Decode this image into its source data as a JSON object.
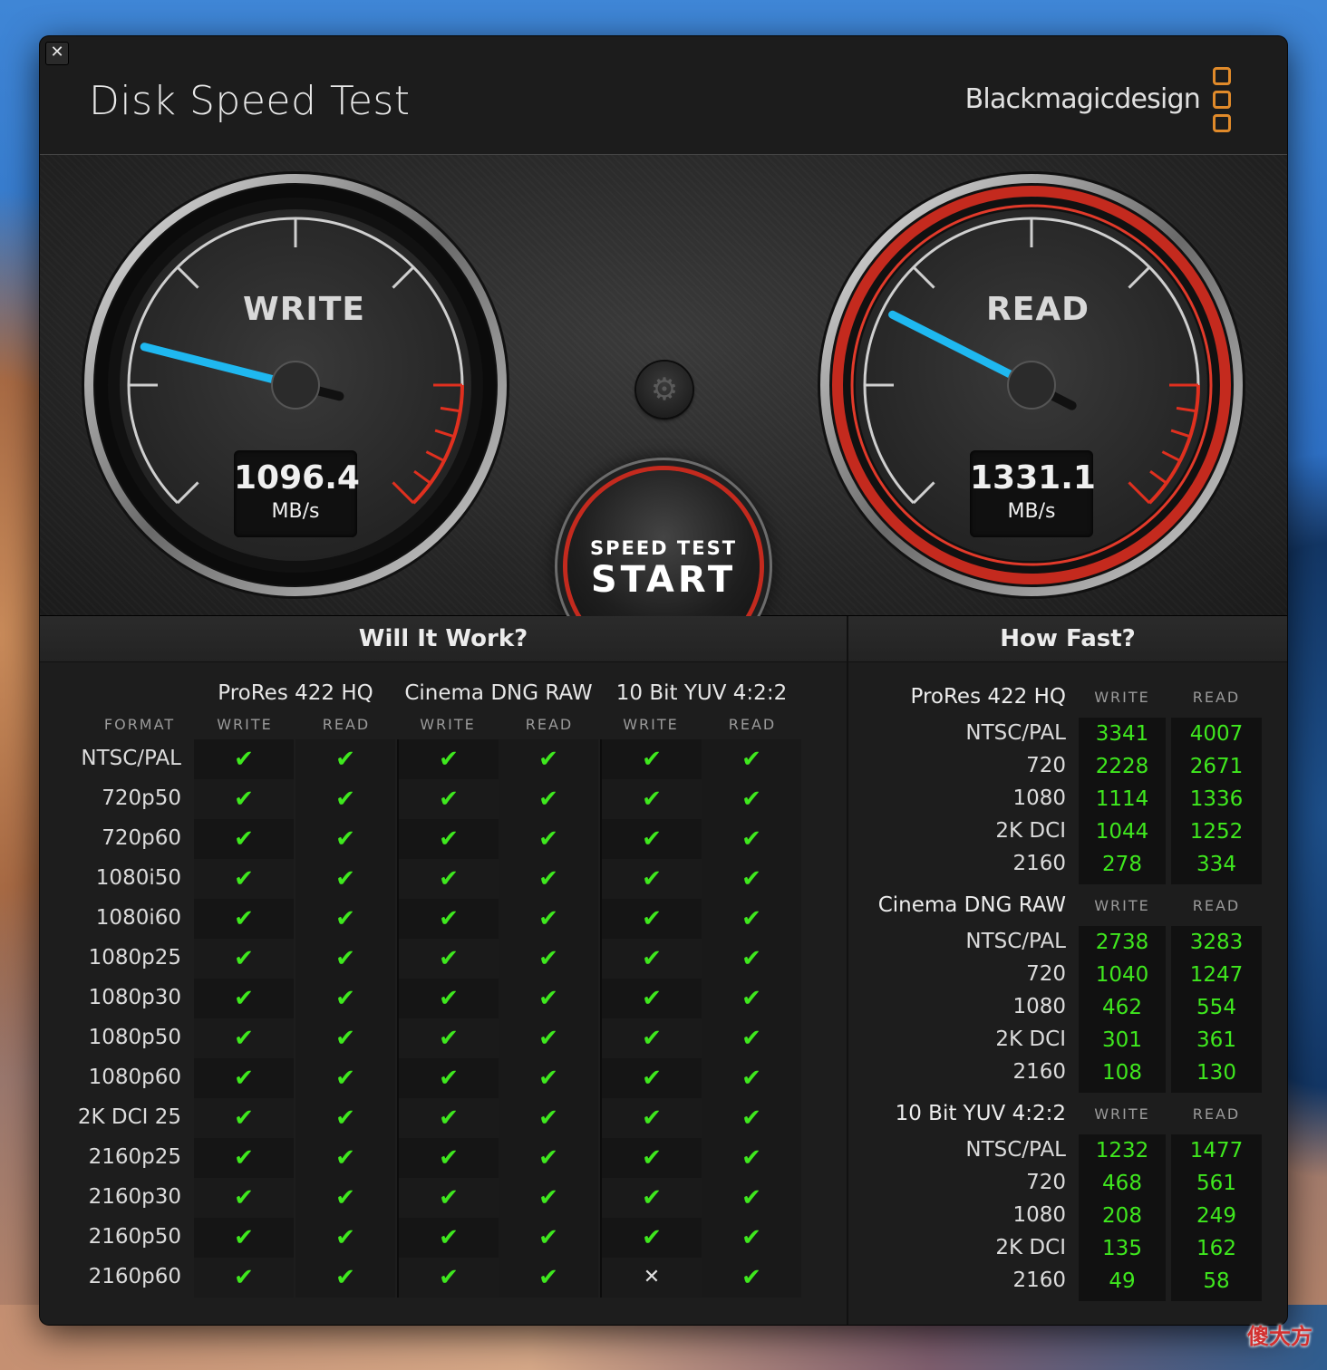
{
  "window": {
    "close": "✕",
    "title": "Disk Speed Test",
    "brand": "Blackmagicdesign"
  },
  "gauges": {
    "write": {
      "label": "WRITE",
      "value": "1096.4",
      "unit": "MB/s"
    },
    "read": {
      "label": "READ",
      "value": "1331.1",
      "unit": "MB/s"
    }
  },
  "start_button": {
    "line1": "SPEED TEST",
    "line2": "START"
  },
  "will_it_work": {
    "title": "Will It Work?",
    "format_header": "FORMAT",
    "codecs": [
      "ProRes 422 HQ",
      "Cinema DNG RAW",
      "10 Bit YUV 4:2:2"
    ],
    "sub_headers": [
      "WRITE",
      "READ"
    ],
    "formats": [
      "NTSC/PAL",
      "720p50",
      "720p60",
      "1080i50",
      "1080i60",
      "1080p25",
      "1080p30",
      "1080p50",
      "1080p60",
      "2K DCI 25",
      "2160p25",
      "2160p30",
      "2160p50",
      "2160p60"
    ],
    "results": [
      [
        "✔",
        "✔",
        "✔",
        "✔",
        "✔",
        "✔"
      ],
      [
        "✔",
        "✔",
        "✔",
        "✔",
        "✔",
        "✔"
      ],
      [
        "✔",
        "✔",
        "✔",
        "✔",
        "✔",
        "✔"
      ],
      [
        "✔",
        "✔",
        "✔",
        "✔",
        "✔",
        "✔"
      ],
      [
        "✔",
        "✔",
        "✔",
        "✔",
        "✔",
        "✔"
      ],
      [
        "✔",
        "✔",
        "✔",
        "✔",
        "✔",
        "✔"
      ],
      [
        "✔",
        "✔",
        "✔",
        "✔",
        "✔",
        "✔"
      ],
      [
        "✔",
        "✔",
        "✔",
        "✔",
        "✔",
        "✔"
      ],
      [
        "✔",
        "✔",
        "✔",
        "✔",
        "✔",
        "✔"
      ],
      [
        "✔",
        "✔",
        "✔",
        "✔",
        "✔",
        "✔"
      ],
      [
        "✔",
        "✔",
        "✔",
        "✔",
        "✔",
        "✔"
      ],
      [
        "✔",
        "✔",
        "✔",
        "✔",
        "✔",
        "✔"
      ],
      [
        "✔",
        "✔",
        "✔",
        "✔",
        "✔",
        "✔"
      ],
      [
        "✔",
        "✔",
        "✔",
        "✔",
        "✕",
        "✔"
      ]
    ]
  },
  "how_fast": {
    "title": "How Fast?",
    "col_write": "WRITE",
    "col_read": "READ",
    "groups": [
      {
        "codec": "ProRes 422 HQ",
        "rows": [
          {
            "format": "NTSC/PAL",
            "write": "3341",
            "read": "4007"
          },
          {
            "format": "720",
            "write": "2228",
            "read": "2671"
          },
          {
            "format": "1080",
            "write": "1114",
            "read": "1336"
          },
          {
            "format": "2K DCI",
            "write": "1044",
            "read": "1252"
          },
          {
            "format": "2160",
            "write": "278",
            "read": "334"
          }
        ]
      },
      {
        "codec": "Cinema DNG RAW",
        "rows": [
          {
            "format": "NTSC/PAL",
            "write": "2738",
            "read": "3283"
          },
          {
            "format": "720",
            "write": "1040",
            "read": "1247"
          },
          {
            "format": "1080",
            "write": "462",
            "read": "554"
          },
          {
            "format": "2K DCI",
            "write": "301",
            "read": "361"
          },
          {
            "format": "2160",
            "write": "108",
            "read": "130"
          }
        ]
      },
      {
        "codec": "10 Bit YUV 4:2:2",
        "rows": [
          {
            "format": "NTSC/PAL",
            "write": "1232",
            "read": "1477"
          },
          {
            "format": "720",
            "write": "468",
            "read": "561"
          },
          {
            "format": "1080",
            "write": "208",
            "read": "249"
          },
          {
            "format": "2K DCI",
            "write": "135",
            "read": "162"
          },
          {
            "format": "2160",
            "write": "49",
            "read": "58"
          }
        ]
      }
    ]
  },
  "colors": {
    "accent_red": "#d0291c",
    "needle_blue": "#1fb8f0",
    "ok_green": "#3fe81e",
    "logo_orange": "#e08a2a"
  },
  "icons": {
    "gear": "gear-icon",
    "check": "check-icon",
    "cross": "cross-icon"
  },
  "watermark": "傻大方"
}
